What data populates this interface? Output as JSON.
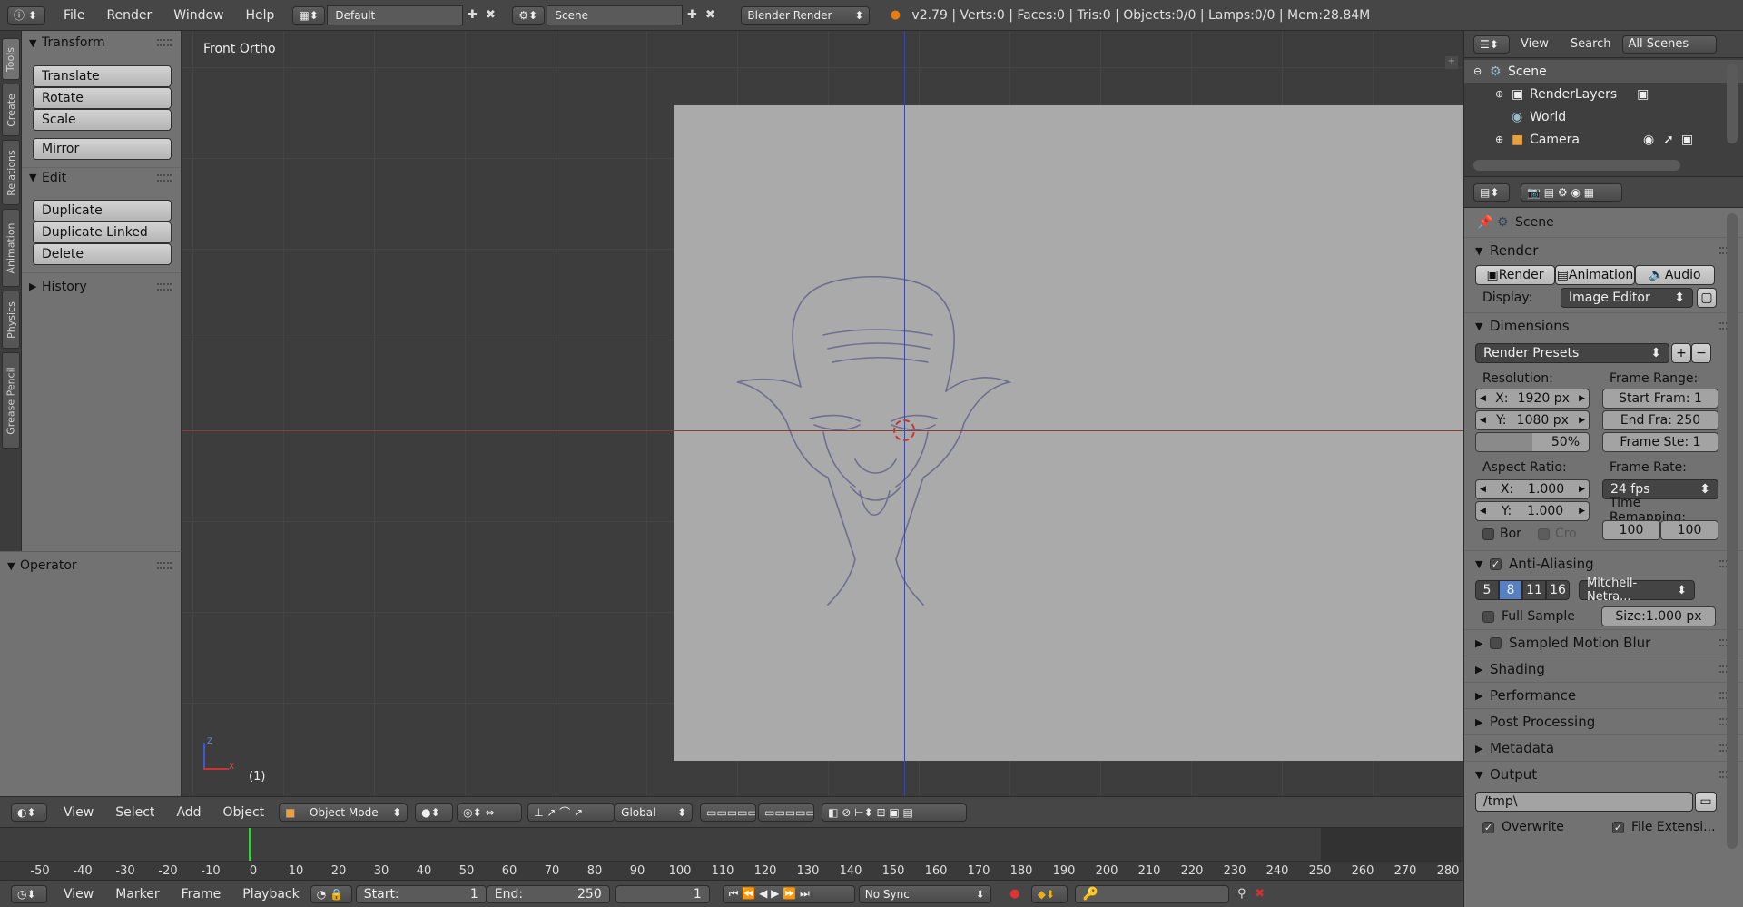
{
  "topbar": {
    "menus": [
      "File",
      "Render",
      "Window",
      "Help"
    ],
    "layout_value": "Default",
    "scene_value": "Scene",
    "engine_value": "Blender Render",
    "stats": "v2.79 | Verts:0 | Faces:0 | Tris:0 | Objects:0/0 | Lamps:0/0 | Mem:28.84M"
  },
  "tool_tabs": [
    "Tools",
    "Create",
    "Relations",
    "Animation",
    "Physics",
    "Grease Pencil"
  ],
  "toolshelf": {
    "transform_title": "Transform",
    "transform_buttons": [
      "Translate",
      "Rotate",
      "Scale"
    ],
    "mirror_label": "Mirror",
    "edit_title": "Edit",
    "edit_buttons": [
      "Duplicate",
      "Duplicate Linked",
      "Delete"
    ],
    "history_title": "History",
    "operator_title": "Operator"
  },
  "viewport": {
    "view_label": "Front Ortho",
    "frame_label": "(1)",
    "axis_z": "Z",
    "axis_x": "X"
  },
  "viewport_header": {
    "menus": [
      "View",
      "Select",
      "Add",
      "Object"
    ],
    "mode_value": "Object Mode",
    "orientation_value": "Global"
  },
  "timeline": {
    "ticks": [
      "-50",
      "-40",
      "-30",
      "-20",
      "-10",
      "0",
      "10",
      "20",
      "30",
      "40",
      "50",
      "60",
      "70",
      "80",
      "90",
      "100",
      "110",
      "120",
      "130",
      "140",
      "150",
      "160",
      "170",
      "180",
      "190",
      "200",
      "210",
      "220",
      "230",
      "240",
      "250",
      "260",
      "270",
      "280"
    ],
    "menus": [
      "View",
      "Marker",
      "Frame",
      "Playback"
    ],
    "start_label": "Start:",
    "start_value": "1",
    "end_label": "End:",
    "end_value": "250",
    "current_frame": "1",
    "sync_value": "No Sync"
  },
  "outliner": {
    "menus": [
      "View",
      "Search"
    ],
    "scope_value": "All Scenes",
    "items": [
      "Scene",
      "RenderLayers",
      "World",
      "Camera"
    ]
  },
  "properties": {
    "context_label": "Scene",
    "render_section": "Render",
    "render_buttons": [
      "Render",
      "Animation",
      "Audio"
    ],
    "display_label": "Display:",
    "display_value": "Image Editor",
    "dimensions_section": "Dimensions",
    "render_presets": "Render Presets",
    "resolution_label": "Resolution:",
    "res_x_label": "X:",
    "res_x_value": "1920 px",
    "res_y_label": "Y:",
    "res_y_value": "1080 px",
    "res_percent": "50%",
    "frame_range_label": "Frame Range:",
    "start_frame": "Start Fram: 1",
    "end_frame": "End Fra: 250",
    "frame_step": "Frame Ste: 1",
    "aspect_label": "Aspect Ratio:",
    "aspect_x_label": "X:",
    "aspect_x_value": "1.000",
    "aspect_y_label": "Y:",
    "aspect_y_value": "1.000",
    "frame_rate_label": "Frame Rate:",
    "fps_value": "24 fps",
    "time_remap_label": "Time Remapping:",
    "remap_old": "100",
    "remap_new": "100",
    "border_label": "Bor",
    "crop_label": "Cro",
    "aa_section": "Anti-Aliasing",
    "aa_samples": [
      "5",
      "8",
      "11",
      "16"
    ],
    "aa_selected": "8",
    "filter_value": "Mitchell-Netra...",
    "full_sample_label": "Full Sample",
    "filter_size": "Size:1.000 px",
    "collapsed_sections": [
      "Sampled Motion Blur",
      "Shading",
      "Performance",
      "Post Processing",
      "Metadata"
    ],
    "output_section": "Output",
    "output_path": "/tmp\\",
    "overwrite_label": "Overwrite",
    "file_ext_label": "File Extensi..."
  }
}
